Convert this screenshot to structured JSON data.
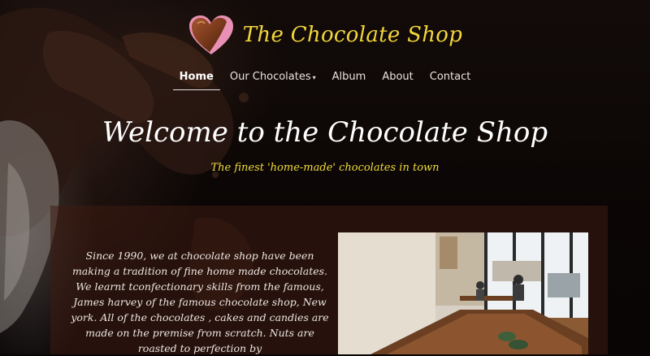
{
  "site": {
    "title": "The Chocolate Shop",
    "accent_color": "#f2d63a",
    "logo_icon": "chocolate-heart-icon"
  },
  "nav": {
    "items": [
      {
        "label": "Home",
        "active": true
      },
      {
        "label": "Our Chocolates",
        "has_dropdown": true
      },
      {
        "label": "Album"
      },
      {
        "label": "About"
      },
      {
        "label": "Contact"
      }
    ]
  },
  "hero": {
    "title": "Welcome to the Chocolate Shop",
    "tagline": "The finest 'home-made' chocolates in town"
  },
  "about": {
    "text": "Since 1990, we at  chocolate shop have been making a tradition of fine home made chocolates. We learnt tconfectionary skills from the famous, James harvey  of the famous chocolate shop, New york. All of the chocolates , cakes and candies are made on the premise from scratch. Nuts are roasted to perfection by"
  }
}
